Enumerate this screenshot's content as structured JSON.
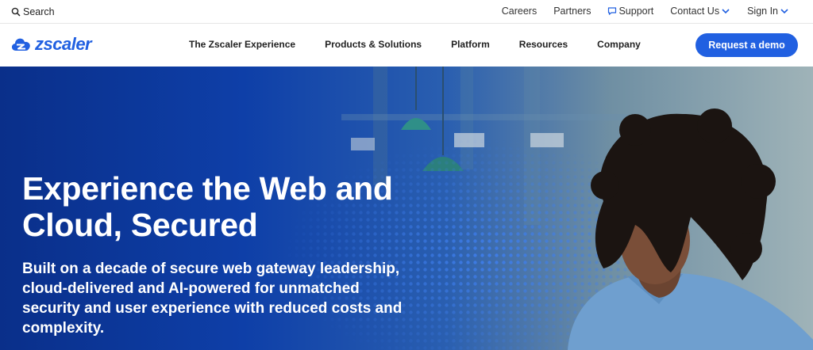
{
  "topbar": {
    "search_label": "Search",
    "links": {
      "careers": "Careers",
      "partners": "Partners",
      "support": "Support",
      "contact": "Contact Us",
      "signin": "Sign In"
    }
  },
  "brand": {
    "logo_text": "zscaler",
    "accent_color": "#2160e1"
  },
  "nav": {
    "items": [
      "The Zscaler Experience",
      "Products & Solutions",
      "Platform",
      "Resources",
      "Company"
    ],
    "cta_label": "Request a demo"
  },
  "hero": {
    "title": "Experience the Web and Cloud, Secured",
    "subtitle": "Built on a decade of secure web gateway leadership, cloud-delivered and AI-powered for unmatched security and user experience with reduced costs and complexity.",
    "image_subject": "woman with curly hair in blue shirt"
  }
}
